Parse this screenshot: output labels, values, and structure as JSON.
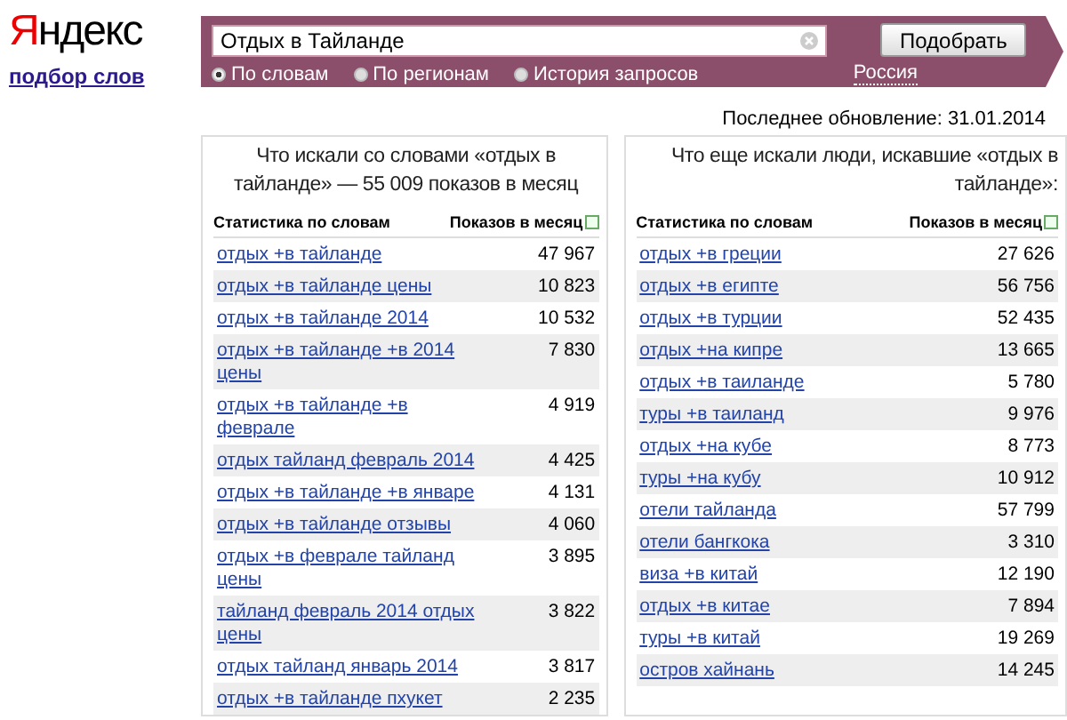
{
  "logo": "Яндекс",
  "service_link": "подбор слов",
  "search": {
    "value": "Отдых в Тайланде",
    "button": "Подобрать",
    "region": "Россия",
    "modes": [
      {
        "label": "По словам",
        "selected": true
      },
      {
        "label": "По регионам",
        "selected": false
      },
      {
        "label": "История запросов",
        "selected": false
      }
    ]
  },
  "last_update": "Последнее обновление: 31.01.2014",
  "panels": [
    {
      "title": "Что искали со словами «отдых в тайланде» — 55 009 показов в месяц",
      "columns": [
        "Статистика по словам",
        "Показов в месяц"
      ],
      "rows": [
        {
          "phrase": "отдых +в тайланде",
          "count": "47 967"
        },
        {
          "phrase": "отдых +в тайланде цены",
          "count": "10 823"
        },
        {
          "phrase": "отдых +в тайланде 2014",
          "count": "10 532"
        },
        {
          "phrase": "отдых +в тайланде +в 2014 цены",
          "count": "7 830"
        },
        {
          "phrase": "отдых +в тайланде +в феврале",
          "count": "4 919"
        },
        {
          "phrase": "отдых тайланд февраль 2014",
          "count": "4 425"
        },
        {
          "phrase": "отдых +в тайланде +в январе",
          "count": "4 131"
        },
        {
          "phrase": "отдых +в тайланде отзывы",
          "count": "4 060"
        },
        {
          "phrase": "отдых +в феврале тайланд цены",
          "count": "3 895"
        },
        {
          "phrase": "тайланд февраль 2014 отдых цены",
          "count": "3 822"
        },
        {
          "phrase": "отдых тайланд январь 2014",
          "count": "3 817"
        },
        {
          "phrase": "отдых +в тайланде пхукет",
          "count": "2 235"
        }
      ]
    },
    {
      "title": "Что еще искали люди, искавшие «отдых в тайланде»:",
      "columns": [
        "Статистика по словам",
        "Показов в месяц"
      ],
      "rows": [
        {
          "phrase": "отдых +в греции",
          "count": "27 626"
        },
        {
          "phrase": "отдых +в египте",
          "count": "56 756"
        },
        {
          "phrase": "отдых +в турции",
          "count": "52 435"
        },
        {
          "phrase": "отдых +на кипре",
          "count": "13 665"
        },
        {
          "phrase": "отдых +в таиланде",
          "count": "5 780"
        },
        {
          "phrase": "туры +в таиланд",
          "count": "9 976"
        },
        {
          "phrase": "отдых +на кубе",
          "count": "8 773"
        },
        {
          "phrase": "туры +на кубу",
          "count": "10 912"
        },
        {
          "phrase": "отели тайланда",
          "count": "57 799"
        },
        {
          "phrase": "отели бангкока",
          "count": "3 310"
        },
        {
          "phrase": "виза +в китай",
          "count": "12 190"
        },
        {
          "phrase": "отдых +в китае",
          "count": "7 894"
        },
        {
          "phrase": "туры +в китай",
          "count": "19 269"
        },
        {
          "phrase": "остров хайнань",
          "count": "14 245"
        }
      ]
    }
  ]
}
